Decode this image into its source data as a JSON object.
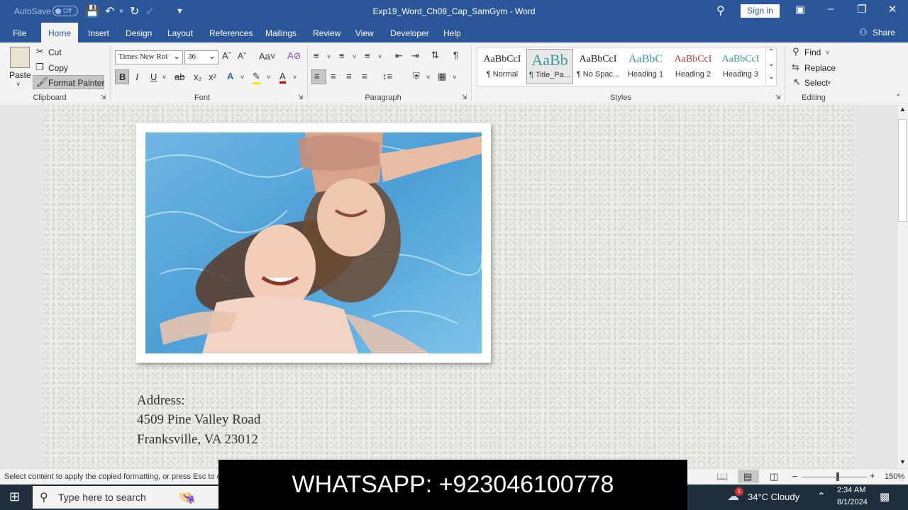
{
  "titlebar": {
    "autosave_label": "AutoSave",
    "autosave_state": "Off",
    "document_title": "Exp19_Word_Ch08_Cap_SamGym - Word",
    "signin_label": "Sign in"
  },
  "tabs": [
    {
      "label": "File"
    },
    {
      "label": "Home"
    },
    {
      "label": "Insert"
    },
    {
      "label": "Design"
    },
    {
      "label": "Layout"
    },
    {
      "label": "References"
    },
    {
      "label": "Mailings"
    },
    {
      "label": "Review"
    },
    {
      "label": "View"
    },
    {
      "label": "Developer"
    },
    {
      "label": "Help"
    }
  ],
  "share_label": "Share",
  "clipboard": {
    "paste": "Paste",
    "cut": "Cut",
    "copy": "Copy",
    "format_painter": "Format Painter",
    "group": "Clipboard"
  },
  "font": {
    "name": "Times New Roi",
    "size": "36",
    "group": "Font"
  },
  "paragraph": {
    "group": "Paragraph"
  },
  "styles": {
    "group": "Styles",
    "items": [
      {
        "preview": "AaBbCcI",
        "name": "¶ Normal",
        "color": "#222222"
      },
      {
        "preview": "AaBb",
        "name": "¶ Title_Pa...",
        "color": "#3a9a9a"
      },
      {
        "preview": "AaBbCcI",
        "name": "¶ No Spac...",
        "color": "#222222"
      },
      {
        "preview": "AaBbC",
        "name": "Heading 1",
        "color": "#3a9a9a"
      },
      {
        "preview": "AaBbCcI",
        "name": "Heading 2",
        "color": "#c0392b"
      },
      {
        "preview": "AaBbCcI",
        "name": "Heading 3",
        "color": "#3a9a9a"
      }
    ]
  },
  "editing": {
    "find": "Find",
    "replace": "Replace",
    "select": "Select",
    "group": "Editing"
  },
  "document": {
    "address_label": "Address:",
    "address_line1": "4509 Pine Valley Road",
    "address_line2": "Franksville, VA 23012"
  },
  "statusbar": {
    "message": "Select content to apply the copied formatting, or press Esc to c",
    "zoom": "150%"
  },
  "taskbar": {
    "search_placeholder": "Type here to search",
    "weather": "34°C  Cloudy",
    "time": "2:34 AM",
    "date": "8/1/2024",
    "notification_count": "1"
  },
  "overlay": {
    "text": "WHATSAPP: +923046100778"
  }
}
